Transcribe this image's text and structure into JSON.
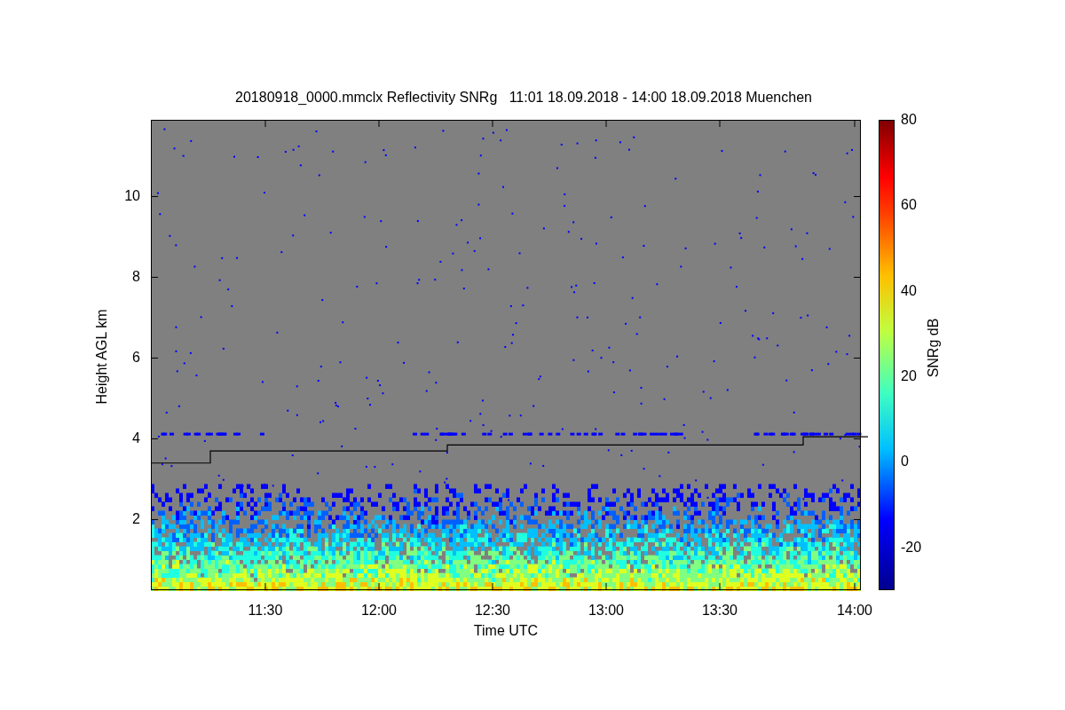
{
  "title": "20180918_0000.mmclx Reflectivity SNRg   11:01 18.09.2018 - 14:00 18.09.2018 Muenchen",
  "plot": {
    "ylabel": "Height AGL km",
    "xlabel": "Time UTC",
    "yticks": [
      "10",
      "8",
      "6",
      "4",
      "2"
    ],
    "xticks": [
      "11:30",
      "12:00",
      "12:30",
      "13:00",
      "13:30",
      "14:00"
    ]
  },
  "colorbar": {
    "label": "SNRg dB",
    "ticks": [
      "80",
      "60",
      "40",
      "20",
      "0",
      "-20"
    ]
  }
}
